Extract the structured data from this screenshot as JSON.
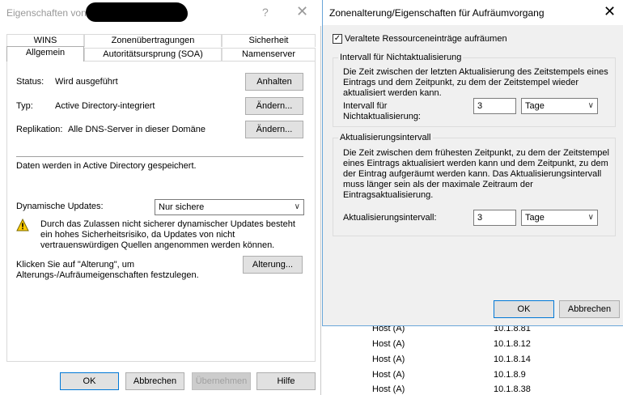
{
  "props_dialog": {
    "title_prefix": "Eigenschaften von",
    "help_glyph": "?",
    "close_glyph": "✕",
    "tabs_row1": [
      "WINS",
      "Zonenübertragungen",
      "Sicherheit"
    ],
    "tabs_row2": [
      "Allgemein",
      "Autoritätsursprung (SOA)",
      "Namenserver"
    ],
    "status_label": "Status:",
    "status_value": "Wird ausgeführt",
    "pause_button": "Anhalten",
    "type_label": "Typ:",
    "type_value": "Active Directory-integriert",
    "type_change_button": "Ändern...",
    "replication_label": "Replikation:",
    "replication_value": "Alle DNS-Server in dieser Domäne",
    "replication_change_button": "Ändern...",
    "stored_text": "Daten werden in Active Directory gespeichert.",
    "dyn_updates_label": "Dynamische Updates:",
    "dyn_updates_value": "Nur sichere",
    "warning_text": "Durch das Zulassen nicht sicherer dynamischer Updates besteht ein hohes Sicherheitsrisiko, da Updates von nicht vertrauenswürdigen Quellen angenommen werden können.",
    "aging_text": "Klicken Sie auf \"Alterung\", um Alterungs-/Aufräumeigenschaften festzulegen.",
    "aging_button": "Alterung...",
    "ok_button": "OK",
    "cancel_button": "Abbrechen",
    "apply_button": "Übernehmen",
    "help_button": "Hilfe"
  },
  "aging_dialog": {
    "title": "Zonenalterung/Eigenschaften für Aufräumvorgang",
    "close_glyph": "✕",
    "scavenge_checkbox_label": "Veraltete Ressourceneinträge aufräumen",
    "scavenge_checked": true,
    "norefresh_group_title": "Intervall für Nichtaktualisierung",
    "norefresh_description": "Die Zeit zwischen der letzten Aktualisierung des Zeitstempels eines Eintrags und dem Zeitpunkt, zu dem der Zeitstempel wieder aktualisiert werden kann.",
    "norefresh_label": "Intervall für Nichtaktualisierung:",
    "norefresh_value": "3",
    "norefresh_unit": "Tage",
    "refresh_group_title": "Aktualisierungsintervall",
    "refresh_description": "Die Zeit zwischen dem frühesten Zeitpunkt, zu dem der Zeitstempel eines Eintrags aktualisiert werden kann und dem Zeitpunkt, zu dem der Eintrag aufgeräumt werden kann. Das Aktualisierungsintervall muss länger sein als der maximale Zeitraum der Eintragsaktualisierung.",
    "refresh_label": "Aktualisierungsintervall:",
    "refresh_value": "3",
    "refresh_unit": "Tage",
    "ok_button": "OK",
    "cancel_button": "Abbrechen"
  },
  "background_records": [
    {
      "type": "Host (A)",
      "ip": "10.1.8.81"
    },
    {
      "type": "Host (A)",
      "ip": "10.1.8.12"
    },
    {
      "type": "Host (A)",
      "ip": "10.1.8.14"
    },
    {
      "type": "Host (A)",
      "ip": "10.1.8.9"
    },
    {
      "type": "Host (A)",
      "ip": "10.1.8.38"
    }
  ],
  "colors": {
    "accent": "#0078d7",
    "button_bg": "#e1e1e1",
    "dialog_bg": "#f0f0f0"
  }
}
